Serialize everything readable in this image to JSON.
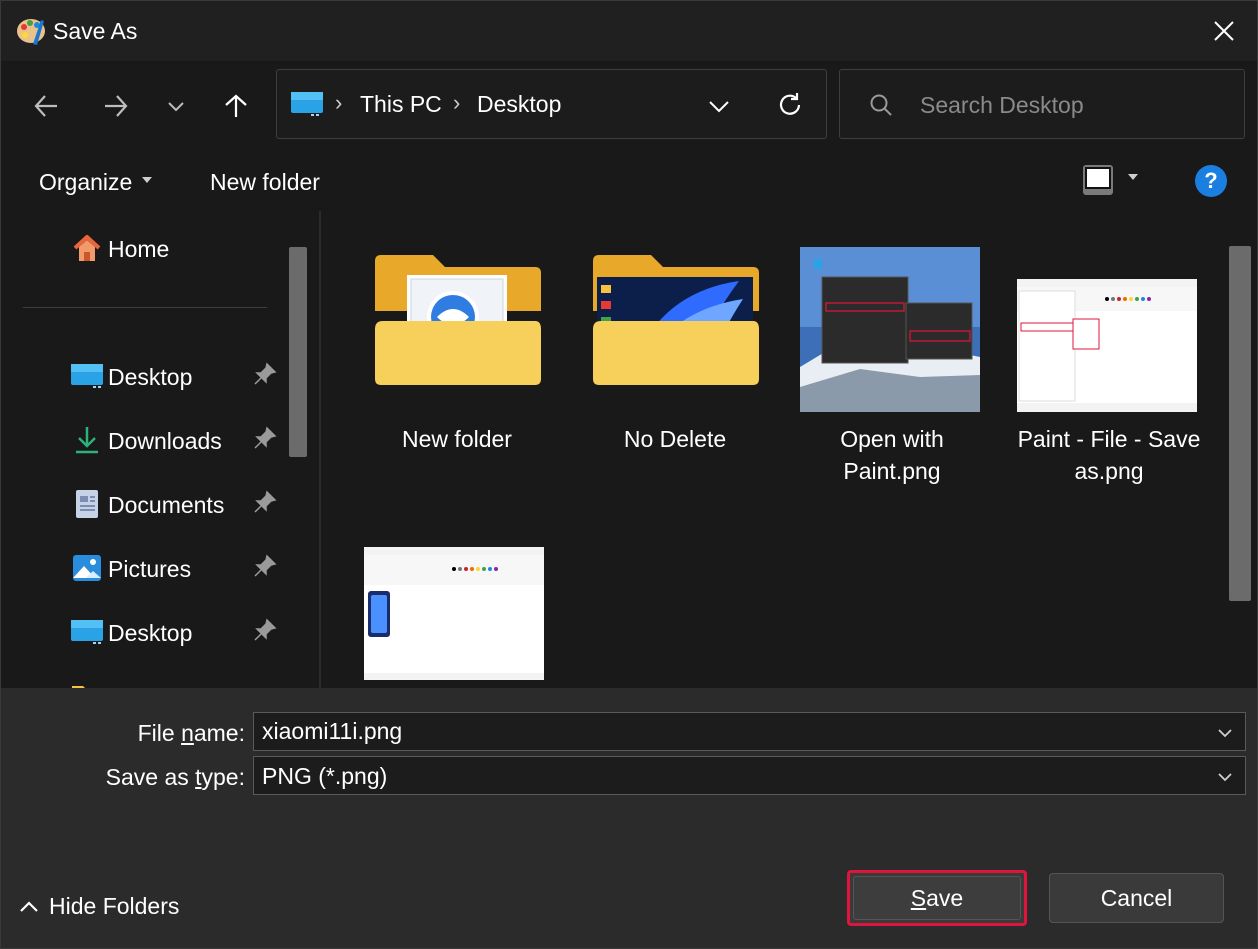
{
  "window": {
    "title": "Save As"
  },
  "nav": {
    "breadcrumbs": [
      "This PC",
      "Desktop"
    ],
    "search_placeholder": "Search Desktop"
  },
  "commandbar": {
    "organize_label": "Organize",
    "new_folder_label": "New folder",
    "help_label": "?"
  },
  "sidebar": {
    "items": [
      {
        "label": "Home",
        "icon": "home-icon",
        "pinned": false
      },
      {
        "label": "Desktop",
        "icon": "desktop-icon",
        "pinned": true
      },
      {
        "label": "Downloads",
        "icon": "downloads-icon",
        "pinned": true
      },
      {
        "label": "Documents",
        "icon": "documents-icon",
        "pinned": true
      },
      {
        "label": "Pictures",
        "icon": "pictures-icon",
        "pinned": true
      },
      {
        "label": "Desktop",
        "icon": "desktop-icon",
        "pinned": true
      }
    ]
  },
  "files": [
    {
      "label": "New folder",
      "type": "folder"
    },
    {
      "label": "No Delete",
      "type": "folder"
    },
    {
      "label": "Open with Paint.png",
      "type": "image"
    },
    {
      "label": "Paint - File - Save as.png",
      "type": "image"
    },
    {
      "label": "",
      "type": "image"
    }
  ],
  "bottom": {
    "file_name_label_pre": "File ",
    "file_name_label_u": "n",
    "file_name_label_post": "ame:",
    "file_name_value": "xiaomi11i.png",
    "save_type_label_pre": "Save as ",
    "save_type_label_u": "t",
    "save_type_label_post": "ype:",
    "save_type_value": "PNG (*.png)",
    "hide_folders_label": "Hide Folders",
    "save_label_u": "S",
    "save_label_post": "ave",
    "cancel_label": "Cancel"
  },
  "colors": {
    "accent": "#1a7fe0",
    "highlight": "#e0143c",
    "folder": "#f5c242"
  }
}
